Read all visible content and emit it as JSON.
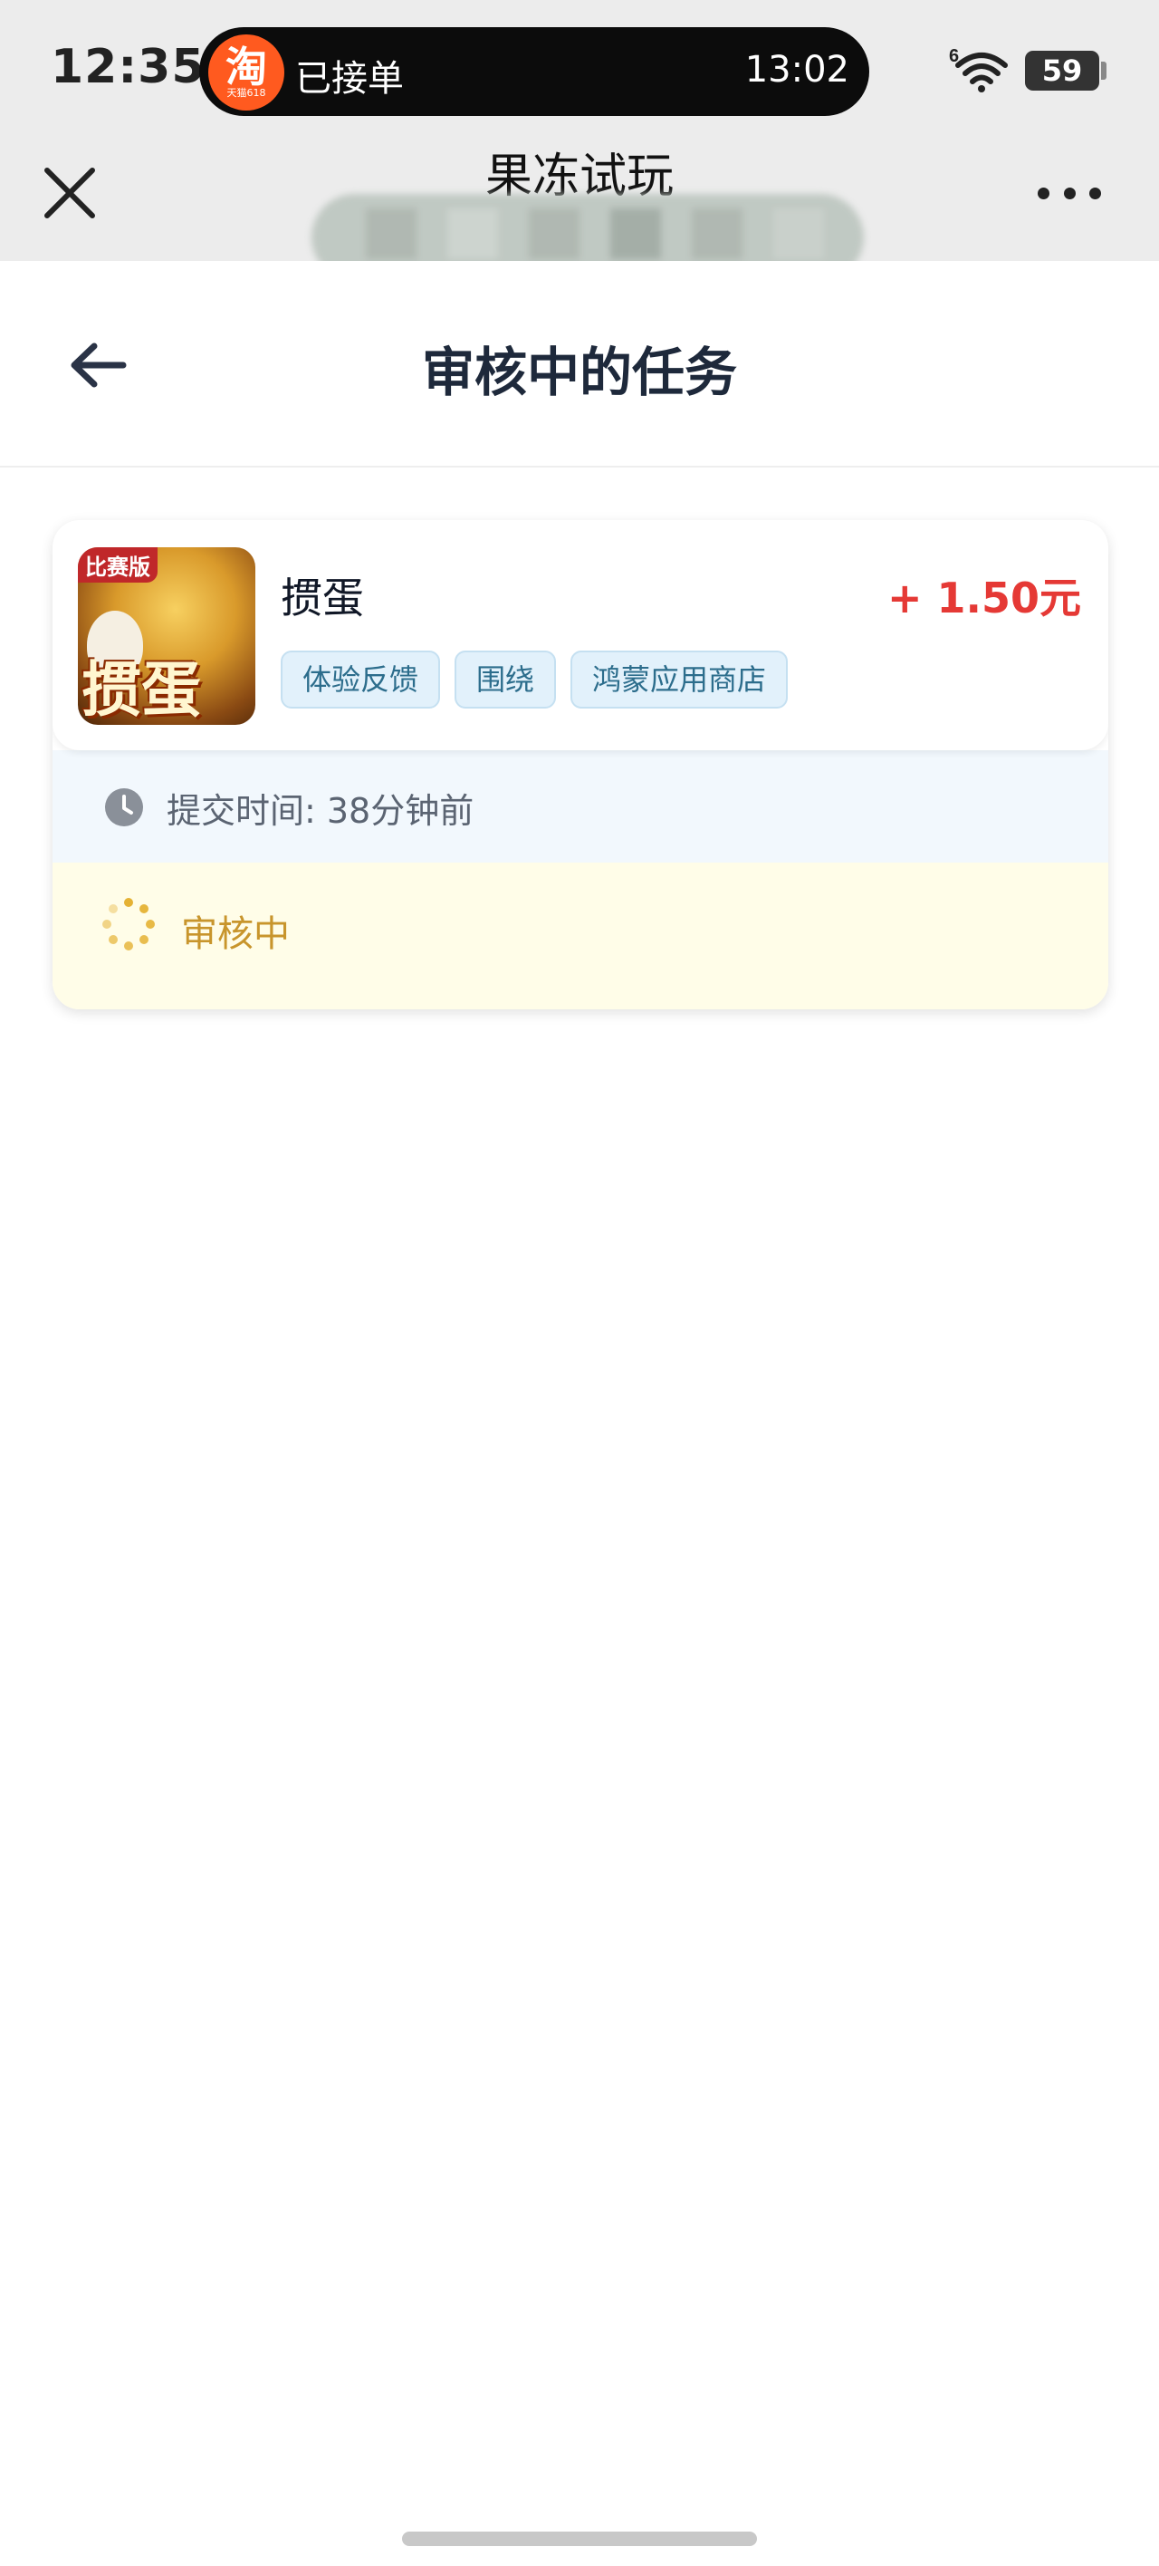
{
  "status_bar": {
    "time": "12:35",
    "island_app_glyph": "淘",
    "island_app_subtext": "天猫618",
    "island_text": "已接单",
    "island_time": "13:02",
    "battery": "59",
    "network_label": "6"
  },
  "browser": {
    "title": "果冻试玩"
  },
  "header": {
    "title": "审核中的任务"
  },
  "task": {
    "icon_badge": "比赛版",
    "icon_word": "掼蛋",
    "name": "掼蛋",
    "reward": "+ 1.50元",
    "tags": [
      "体验反馈",
      "围绕",
      "鸿蒙应用商店"
    ],
    "submit_time": "提交时间: 38分钟前",
    "status": "审核中"
  },
  "colors": {
    "reward": "#e53935",
    "status": "#c8952c",
    "tag_text": "#2c6d8c",
    "tag_bg": "#e2f1fb"
  }
}
